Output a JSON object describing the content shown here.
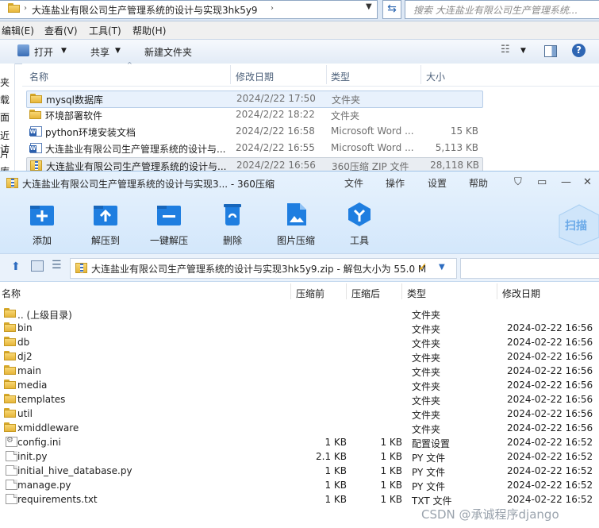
{
  "explorer": {
    "address_path": "大连盐业有限公司生产管理系统的设计与实现3hk5y9",
    "search_placeholder": "搜索 大连盐业有限公司生产管理系统...",
    "menu": [
      "编辑(E)",
      "查看(V)",
      "工具(T)",
      "帮助(H)"
    ],
    "toolbar": {
      "open": "打开",
      "share": "共享",
      "new_folder": "新建文件夹"
    },
    "columns": {
      "name": "名称",
      "modified": "修改日期",
      "type": "类型",
      "size": "大小"
    },
    "left_nav": [
      "夹",
      "载",
      "面",
      "近访",
      "片",
      "库"
    ],
    "files": [
      {
        "name": "mysql数据库",
        "date": "2024/2/22 17:50",
        "type": "文件夹",
        "size": "",
        "icon": "folder-icon"
      },
      {
        "name": "环境部署软件",
        "date": "2024/2/22 18:22",
        "type": "文件夹",
        "size": "",
        "icon": "folder-icon"
      },
      {
        "name": "python环境安装文档",
        "date": "2024/2/22 16:58",
        "type": "Microsoft Word ...",
        "size": "15 KB",
        "icon": "word-icon"
      },
      {
        "name": "大连盐业有限公司生产管理系统的设计与...",
        "date": "2024/2/22 16:55",
        "type": "Microsoft Word ...",
        "size": "5,113 KB",
        "icon": "word-icon"
      },
      {
        "name": "大连盐业有限公司生产管理系统的设计与...",
        "date": "2024/2/22 16:56",
        "type": "360压缩 ZIP 文件",
        "size": "28,118 KB",
        "icon": "zip-icon"
      }
    ]
  },
  "zip": {
    "title": "大连盐业有限公司生产管理系统的设计与实现3... - 360压缩",
    "menu": [
      "文件",
      "操作",
      "设置",
      "帮助"
    ],
    "tools": [
      "添加",
      "解压到",
      "一键解压",
      "删除",
      "图片压缩",
      "工具"
    ],
    "scan_label": "扫描",
    "path": "大连盐业有限公司生产管理系统的设计与实现3hk5y9.zip - 解包大小为 55.0 M",
    "columns": {
      "name": "名称",
      "before": "压缩前",
      "after": "压缩后",
      "type": "类型",
      "modified": "修改日期"
    },
    "rows": [
      {
        "name": ".. (上级目录)",
        "before": "",
        "after": "",
        "type": "文件夹",
        "date": "",
        "icon": "folder-icon"
      },
      {
        "name": "bin",
        "before": "",
        "after": "",
        "type": "文件夹",
        "date": "2024-02-22 16:56",
        "icon": "folder-icon"
      },
      {
        "name": "db",
        "before": "",
        "after": "",
        "type": "文件夹",
        "date": "2024-02-22 16:56",
        "icon": "folder-icon"
      },
      {
        "name": "dj2",
        "before": "",
        "after": "",
        "type": "文件夹",
        "date": "2024-02-22 16:56",
        "icon": "folder-icon"
      },
      {
        "name": "main",
        "before": "",
        "after": "",
        "type": "文件夹",
        "date": "2024-02-22 16:56",
        "icon": "folder-icon"
      },
      {
        "name": "media",
        "before": "",
        "after": "",
        "type": "文件夹",
        "date": "2024-02-22 16:56",
        "icon": "folder-icon"
      },
      {
        "name": "templates",
        "before": "",
        "after": "",
        "type": "文件夹",
        "date": "2024-02-22 16:56",
        "icon": "folder-icon"
      },
      {
        "name": "util",
        "before": "",
        "after": "",
        "type": "文件夹",
        "date": "2024-02-22 16:56",
        "icon": "folder-icon"
      },
      {
        "name": "xmiddleware",
        "before": "",
        "after": "",
        "type": "文件夹",
        "date": "2024-02-22 16:56",
        "icon": "folder-icon"
      },
      {
        "name": "config.ini",
        "before": "1 KB",
        "after": "1 KB",
        "type": "配置设置",
        "date": "2024-02-22 16:52",
        "icon": "config-file-icon"
      },
      {
        "name": "init.py",
        "before": "2.1 KB",
        "after": "1 KB",
        "type": "PY 文件",
        "date": "2024-02-22 16:52",
        "icon": "file-icon"
      },
      {
        "name": "initial_hive_database.py",
        "before": "1 KB",
        "after": "1 KB",
        "type": "PY 文件",
        "date": "2024-02-22 16:52",
        "icon": "file-icon"
      },
      {
        "name": "manage.py",
        "before": "1 KB",
        "after": "1 KB",
        "type": "PY 文件",
        "date": "2024-02-22 16:52",
        "icon": "file-icon"
      },
      {
        "name": "requirements.txt",
        "before": "1 KB",
        "after": "1 KB",
        "type": "TXT 文件",
        "date": "2024-02-22 16:52",
        "icon": "file-icon"
      }
    ]
  },
  "watermark": "CSDN @承诚程序django"
}
